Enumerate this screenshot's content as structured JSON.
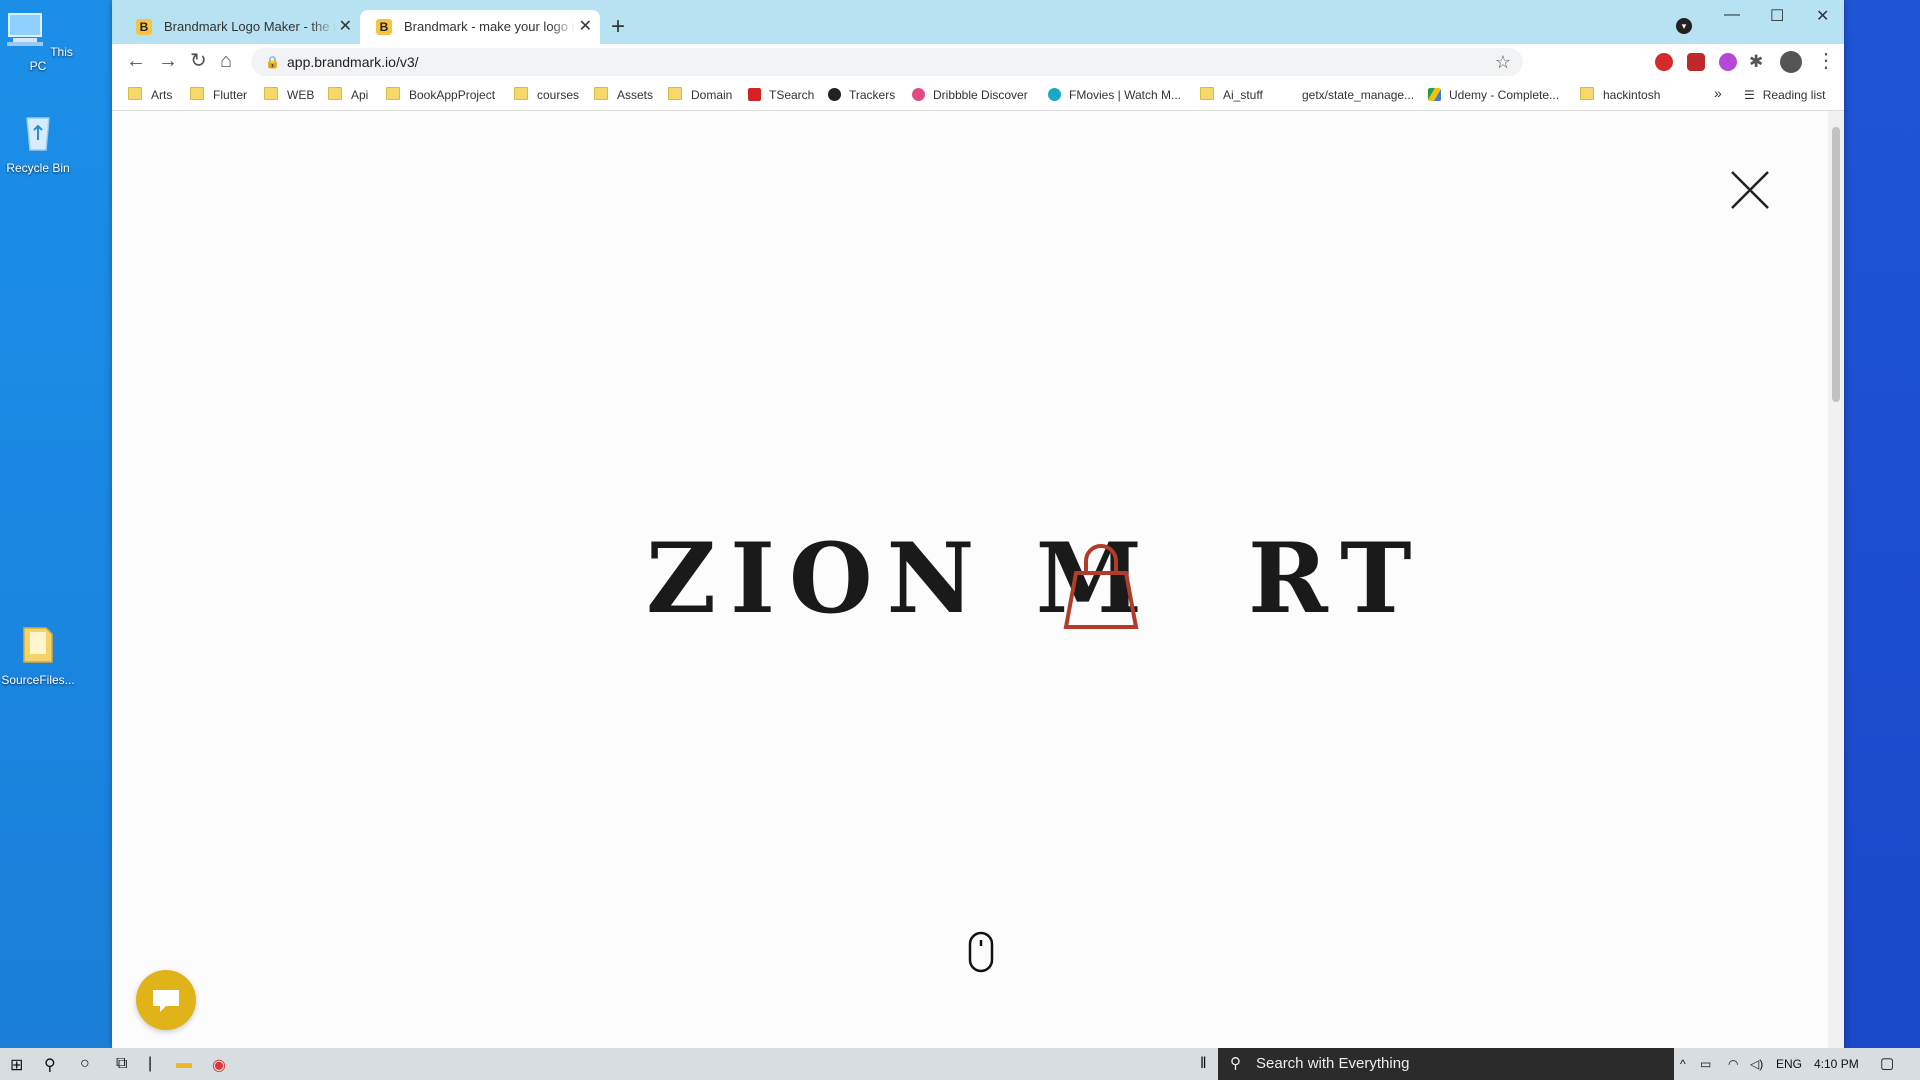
{
  "desktop": {
    "icons": [
      {
        "label": "This PC",
        "icon": "computer-icon"
      },
      {
        "label": "Recycle Bin",
        "icon": "recycle-bin-icon"
      },
      {
        "label": "SourceFiles...",
        "icon": "folder-icon"
      }
    ]
  },
  "browser": {
    "tabs": [
      {
        "title": "Brandmark Logo Maker - the mo",
        "favicon": "B",
        "active": false
      },
      {
        "title": "Brandmark - make your logo in m",
        "favicon": "B",
        "active": true
      }
    ],
    "new_tab": "+",
    "url": "app.brandmark.io/v3/",
    "bookmarks": [
      {
        "label": "Arts",
        "type": "folder"
      },
      {
        "label": "Flutter",
        "type": "folder"
      },
      {
        "label": "WEB",
        "type": "folder"
      },
      {
        "label": "Api",
        "type": "folder"
      },
      {
        "label": "BookAppProject",
        "type": "folder"
      },
      {
        "label": "courses",
        "type": "folder"
      },
      {
        "label": "Assets",
        "type": "folder"
      },
      {
        "label": "Domain",
        "type": "folder"
      },
      {
        "label": "TSearch",
        "type": "site"
      },
      {
        "label": "Trackers",
        "type": "github"
      },
      {
        "label": "Dribbble Discover",
        "type": "dribbble"
      },
      {
        "label": "FMovies | Watch M...",
        "type": "site"
      },
      {
        "label": "Ai_stuff",
        "type": "folder"
      },
      {
        "label": "getx/state_manage...",
        "type": "site"
      },
      {
        "label": "Udemy - Complete...",
        "type": "drive"
      },
      {
        "label": "hackintosh",
        "type": "folder"
      }
    ],
    "bookmarks_overflow": "»",
    "reading_list": "Reading list"
  },
  "page": {
    "logo_text_left": "ZION M",
    "logo_text_right": "RT",
    "logo_accent_color": "#b13c2a",
    "chat_color": "#e0b318"
  },
  "taskbar": {
    "search_placeholder": "Search with Everything",
    "language": "ENG",
    "time": "4:10 PM"
  }
}
